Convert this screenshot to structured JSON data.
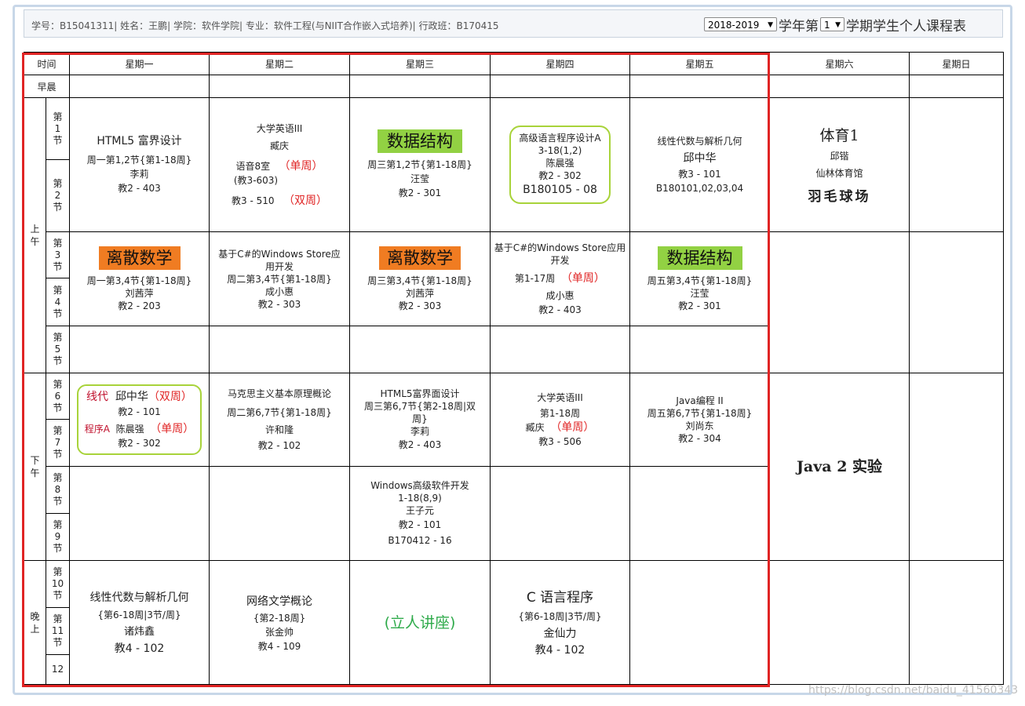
{
  "header": {
    "student_info": "学号：B15041311| 姓名：王鹏| 学院：软件学院| 专业：软件工程(与NIIT合作嵌入式培养)| 行政班：B170415",
    "year_value": "2018-2019",
    "year_suffix": "学年第",
    "term_value": "1",
    "title_suffix": "学期学生个人课程表"
  },
  "columns": {
    "time": "时间",
    "mon": "星期一",
    "tue": "星期二",
    "wed": "星期三",
    "thu": "星期四",
    "fri": "星期五",
    "sat": "星期六",
    "sun": "星期日"
  },
  "rows": {
    "morning_early": "早晨",
    "am": "上午",
    "pm": "下午",
    "eve": "晚上",
    "p1": "第1节",
    "p2": "第2节",
    "p3": "第3节",
    "p4": "第4节",
    "p5": "第5节",
    "p6": "第6节",
    "p7": "第7节",
    "p8": "第8节",
    "p9": "第9节",
    "p10": "第10节",
    "p11": "第11节",
    "p12": "12"
  },
  "courses": {
    "mon_12": {
      "name": "HTML5 富界设计",
      "time": "周一第1,2节{第1-18周}",
      "teacher": "李莉",
      "room": "教2 - 403"
    },
    "tue_12": {
      "name": "大学英语III",
      "teacher": "臧庆",
      "room1": "语音8室",
      "room1b": "(教3-603)",
      "note1": "（单周）",
      "room2": "教3 - 510",
      "note2": "（双周）"
    },
    "wed_12": {
      "name": "数据结构",
      "time": "周三第1,2节{第1-18周}",
      "teacher": "汪莹",
      "room": "教2 - 301"
    },
    "thu_12": {
      "name": "高级语言程序设计A",
      "weeks": "3-18(1,2)",
      "teacher": "陈晨强",
      "room": "教2 - 302",
      "group": "B180105 - 08"
    },
    "fri_12": {
      "name": "线性代数与解析几何",
      "teacher": "邱中华",
      "room": "教3 - 101",
      "group": "B180101,02,03,04"
    },
    "sat_am": {
      "name": "体育1",
      "teacher": "邱锴",
      "place": "仙林体育馆",
      "note": "羽毛球场"
    },
    "mon_34": {
      "name": "离散数学",
      "time": "周一第3,4节{第1-18周}",
      "teacher": "刘茜萍",
      "room": "教2 - 203"
    },
    "tue_34": {
      "name": "基于C#的Windows Store应用开发",
      "time": "周二第3,4节{第1-18周}",
      "teacher": "成小惠",
      "room": "教2 - 303"
    },
    "wed_34": {
      "name": "离散数学",
      "time": "周三第3,4节{第1-18周}",
      "teacher": "刘茜萍",
      "room": "教2 - 303"
    },
    "thu_34": {
      "name": "基于C#的Windows Store应用开发",
      "weeks": "第1-17周",
      "note": "（单周）",
      "teacher": "成小惠",
      "room": "教2 - 403"
    },
    "fri_34": {
      "name": "数据结构",
      "time": "周五第3,4节{第1-18周}",
      "teacher": "汪莹",
      "room": "教2 - 301"
    },
    "mon_67": {
      "a_name": "线代",
      "a_teacher": "邱中华",
      "a_note": "（双周）",
      "a_room": "教2 - 101",
      "b_name": "程序A",
      "b_teacher": "陈晨强",
      "b_note": "（单周）",
      "b_room": "教2 - 302"
    },
    "tue_67": {
      "name": "马克思主义基本原理概论",
      "time": "周二第6,7节{第1-18周}",
      "teacher": "许和隆",
      "room": "教2 - 102"
    },
    "wed_67": {
      "name": "HTML5富界面设计",
      "time": "周三第6,7节{第2-18周|双周}",
      "teacher": "李莉",
      "room": "教2 - 403"
    },
    "thu_67": {
      "name": "大学英语III",
      "weeks": "第1-18周",
      "teacher": "臧庆",
      "note": "（单周）",
      "room": "教3 - 506"
    },
    "fri_67": {
      "name": "Java编程 II",
      "time": "周五第6,7节{第1-18周}",
      "teacher": "刘尚东",
      "room": "教2 - 304"
    },
    "sat_pm": {
      "name": "Java 2 实验"
    },
    "wed_89": {
      "name": "Windows高级软件开发",
      "weeks": "1-18(8,9)",
      "teacher": "王子元",
      "room": "教2 - 101",
      "group": "B170412 - 16"
    },
    "mon_eve": {
      "name": "线性代数与解析几何",
      "time": "{第6-18周|3节/周}",
      "teacher": "诸炜鑫",
      "room": "教4 - 102"
    },
    "tue_eve": {
      "name": "网络文学概论",
      "time": "{第2-18周}",
      "teacher": "张金帅",
      "room": "教4 - 109"
    },
    "wed_eve": {
      "name": "(立人讲座)"
    },
    "thu_eve": {
      "name": "C 语言程序",
      "time": "{第6-18周|3节/周}",
      "teacher": "金仙力",
      "room": "教4 - 102"
    }
  },
  "watermark": "https://blog.csdn.net/baidu_41560343",
  "colors": {
    "red_outline": "#e02424",
    "orange_tag": "#f07c22",
    "green_tag": "#92d143",
    "green_box": "#a8d33a",
    "red_note": "#e02424"
  }
}
